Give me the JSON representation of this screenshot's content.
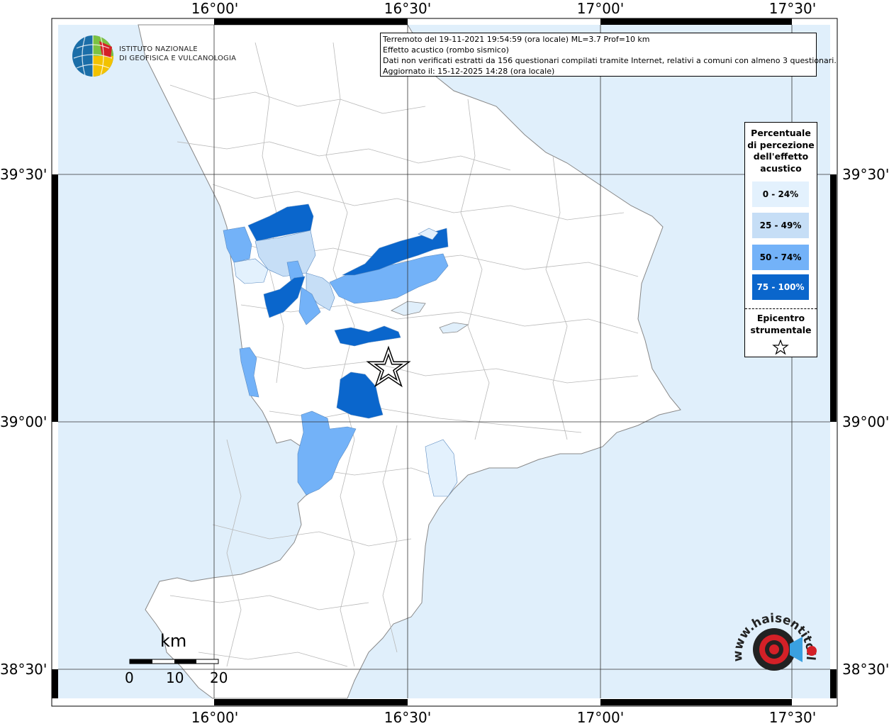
{
  "info": {
    "line1": "Terremoto del 19-11-2021 19:54:59 (ora locale) ML=3.7 Prof=10 km",
    "line2": "Effetto acustico (rombo sismico)",
    "line3": "Dati non verificati estratti da 156 questionari compilati tramite Internet, relativi a comuni con almeno 3 questionari.",
    "line4": "Aggiornato il: 15-12-2025 14:28 (ora locale)"
  },
  "logo": {
    "line1": "ISTITUTO NAZIONALE",
    "line2": "DI GEOFISICA E VULCANOLOGIA",
    "icon": "ingv-globe-icon"
  },
  "legend": {
    "title_lines": [
      "Percentuale",
      "di percezione",
      "dell'effetto",
      "acustico"
    ],
    "items": [
      {
        "label": "0 - 24%",
        "color": "#e3f1fd"
      },
      {
        "label": "25 - 49%",
        "color": "#c6def6"
      },
      {
        "label": "50 - 74%",
        "color": "#73b2f8"
      },
      {
        "label": "75 - 100%",
        "color": "#0a66cc"
      }
    ],
    "epicenter_lines": [
      "Epicentro",
      "strumentale"
    ],
    "epicenter_icon": "star-icon"
  },
  "axes": {
    "lon_labels": [
      "16°00'",
      "16°30'",
      "17°00'",
      "17°30'"
    ],
    "lat_labels": [
      "39°30'",
      "39°00'",
      "38°30'"
    ]
  },
  "scale_bar": {
    "unit": "km",
    "labels": [
      "0",
      "10",
      "20"
    ]
  },
  "watermark": {
    "text": "www.haisentitoilterremoto.it",
    "icon": "target-icon"
  },
  "colors": {
    "sea": "#e0effb",
    "land": "#ffffff",
    "class_low": "#e3f1fd",
    "class_mid": "#c6def6",
    "class_high": "#73b2f8",
    "class_max": "#0a66cc",
    "hsi_red": "#d42027"
  }
}
